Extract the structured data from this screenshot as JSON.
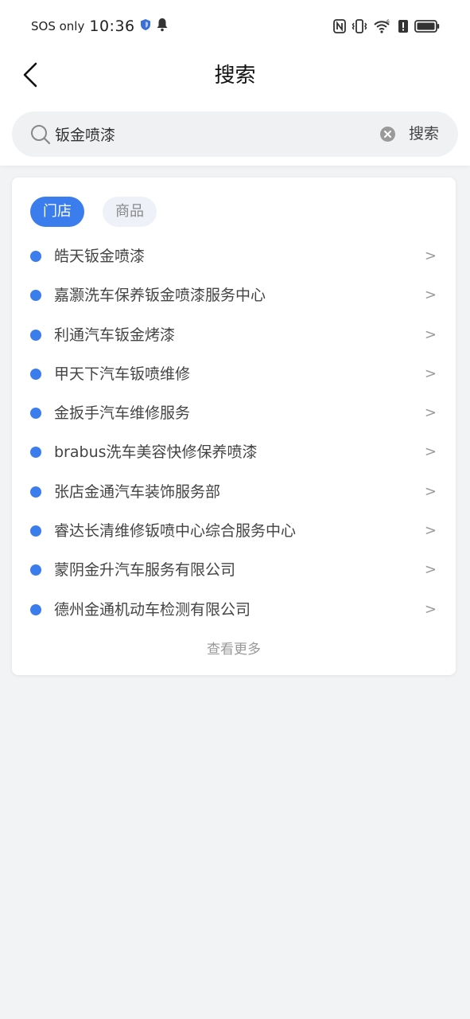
{
  "status_bar": {
    "carrier": "SOS only",
    "time": "10:36"
  },
  "nav": {
    "title": "搜索"
  },
  "search": {
    "value": "钣金喷漆",
    "placeholder": "",
    "button_label": "搜索"
  },
  "tabs": [
    {
      "label": "门店",
      "active": true
    },
    {
      "label": "商品",
      "active": false
    }
  ],
  "results": [
    {
      "name": "皓天钣金喷漆",
      "arrow": ">"
    },
    {
      "name": "嘉灏洗车保养钣金喷漆服务中心",
      "arrow": ">"
    },
    {
      "name": "利通汽车钣金烤漆",
      "arrow": ">"
    },
    {
      "name": "甲天下汽车钣喷维修",
      "arrow": ">"
    },
    {
      "name": "金扳手汽车维修服务",
      "arrow": ">"
    },
    {
      "name": "brabus洗车美容快修保养喷漆",
      "arrow": ">"
    },
    {
      "name": "张店金通汽车装饰服务部",
      "arrow": ">"
    },
    {
      "name": "睿达长清维修钣喷中心综合服务中心",
      "arrow": ">"
    },
    {
      "name": "蒙阴金升汽车服务有限公司",
      "arrow": ">"
    },
    {
      "name": "德州金通机动车检测有限公司",
      "arrow": ">"
    }
  ],
  "see_more_label": "查看更多",
  "colors": {
    "accent": "#3b7ded",
    "background": "#f2f3f5"
  }
}
